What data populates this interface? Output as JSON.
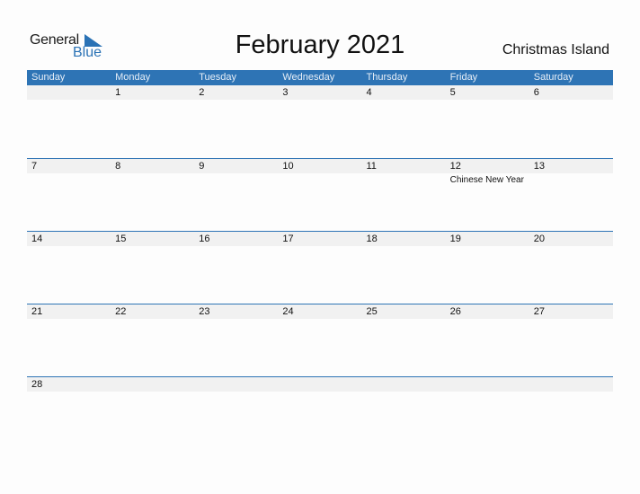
{
  "logo": {
    "text1": "General",
    "text2": "Blue"
  },
  "title": "February 2021",
  "country": "Christmas Island",
  "weekdays": [
    "Sunday",
    "Monday",
    "Tuesday",
    "Wednesday",
    "Thursday",
    "Friday",
    "Saturday"
  ],
  "weeks": [
    {
      "days": [
        "",
        "1",
        "2",
        "3",
        "4",
        "5",
        "6"
      ],
      "events": [
        "",
        "",
        "",
        "",
        "",
        "",
        ""
      ]
    },
    {
      "days": [
        "7",
        "8",
        "9",
        "10",
        "11",
        "12",
        "13"
      ],
      "events": [
        "",
        "",
        "",
        "",
        "",
        "Chinese New Year",
        ""
      ]
    },
    {
      "days": [
        "14",
        "15",
        "16",
        "17",
        "18",
        "19",
        "20"
      ],
      "events": [
        "",
        "",
        "",
        "",
        "",
        "",
        ""
      ]
    },
    {
      "days": [
        "21",
        "22",
        "23",
        "24",
        "25",
        "26",
        "27"
      ],
      "events": [
        "",
        "",
        "",
        "",
        "",
        "",
        ""
      ]
    },
    {
      "days": [
        "28",
        "",
        "",
        "",
        "",
        "",
        ""
      ],
      "events": [
        "",
        "",
        "",
        "",
        "",
        "",
        ""
      ]
    }
  ]
}
